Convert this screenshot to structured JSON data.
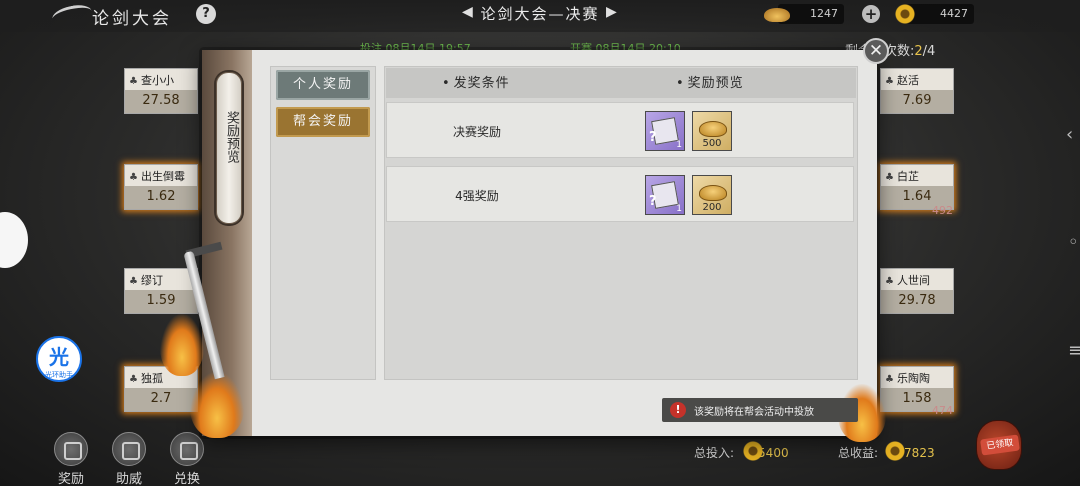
{
  "header": {
    "app_title": "论剑大会",
    "stage_title": "论剑大会—决赛",
    "prev_arrow": "◀",
    "next_arrow": "▶",
    "ingot_count": "1247",
    "flower_count": "4427",
    "help_glyph": "?",
    "plus_glyph": "+"
  },
  "board": {
    "time_left": "投注  08月14日 19:57",
    "time_right": "开赛  08月14日 20:10",
    "right_count_label": "剩余场次数:",
    "right_count_current": "2",
    "right_count_total": "/4",
    "players_left": [
      {
        "name": "查小小",
        "value": "27.58"
      },
      {
        "name": "出生倒霉",
        "value": "1.62"
      },
      {
        "name": "缪订",
        "value": "1.59"
      },
      {
        "name": "独孤",
        "value": "2.7"
      }
    ],
    "players_right": [
      {
        "name": "赵活",
        "value": "7.69"
      },
      {
        "name": "白芷",
        "value": "1.64"
      },
      {
        "name": "人世间",
        "value": "29.78"
      },
      {
        "name": "乐陶陶",
        "value": "1.58"
      }
    ],
    "side_num_1": "492",
    "side_num_2": "474"
  },
  "assistant_badge": {
    "glyph": "光",
    "caption": "光环助手"
  },
  "bottom_nav": [
    {
      "label": "奖励"
    },
    {
      "label": "助威"
    },
    {
      "label": "兑换"
    }
  ],
  "bottom_stats": {
    "invest_label": "总投入:",
    "invest_value": "5400",
    "income_label": "总收益:",
    "income_value": "7823",
    "bag_tag": "已领取"
  },
  "modal": {
    "scroll_label": "奖励预览",
    "close_glyph": "✕",
    "tabs": [
      {
        "label": "个人奖励",
        "state": "selected"
      },
      {
        "label": "帮会奖励",
        "state": "normal"
      }
    ],
    "columns": [
      "发奖条件",
      "奖励预览"
    ],
    "rows": [
      {
        "condition": "决赛奖励",
        "items": [
          {
            "type": "book-box",
            "amount": "1"
          },
          {
            "type": "ingot",
            "amount": "500"
          }
        ]
      },
      {
        "condition": "4强奖励",
        "items": [
          {
            "type": "book-box",
            "amount": "1"
          },
          {
            "type": "ingot",
            "amount": "200"
          }
        ]
      }
    ],
    "notice_glyph": "!",
    "notice": "该奖励将在帮会活动中投放"
  },
  "colors": {
    "accent_gold": "#9a7431",
    "accent_slate": "#6d7a78",
    "highlight_green": "#6dbb4e",
    "value_gold": "#e3c14c"
  }
}
